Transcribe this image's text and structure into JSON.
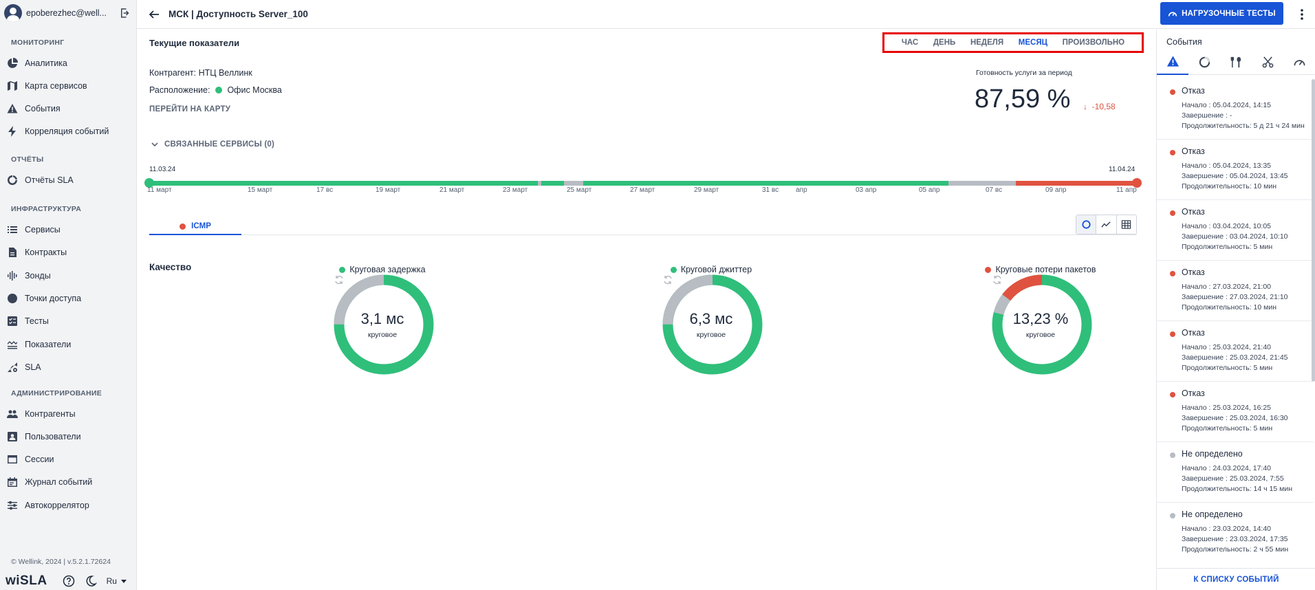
{
  "user": {
    "name": "epoberezhec@well..."
  },
  "sidebar": {
    "sections": [
      {
        "title": "МОНИТОРИНГ",
        "items": [
          {
            "label": "Аналитика",
            "icon": "pie-chart-icon"
          },
          {
            "label": "Карта сервисов",
            "icon": "map-icon"
          },
          {
            "label": "События",
            "icon": "warning-icon"
          },
          {
            "label": "Корреляция событий",
            "icon": "lightning-icon"
          }
        ]
      },
      {
        "title": "ОТЧЁТЫ",
        "items": [
          {
            "label": "Отчёты SLA",
            "icon": "donut-icon"
          }
        ]
      },
      {
        "title": "ИНФРАСТРУКТУРА",
        "items": [
          {
            "label": "Сервисы",
            "icon": "list-icon"
          },
          {
            "label": "Контракты",
            "icon": "document-icon"
          },
          {
            "label": "Зонды",
            "icon": "waveform-icon"
          },
          {
            "label": "Точки доступа",
            "icon": "circle-icon"
          },
          {
            "label": "Тесты",
            "icon": "checklist-icon"
          },
          {
            "label": "Показатели",
            "icon": "layers-icon"
          },
          {
            "label": "SLA",
            "icon": "signal-gear-icon"
          }
        ]
      },
      {
        "title": "АДМИНИСТРИРОВАНИЕ",
        "items": [
          {
            "label": "Контрагенты",
            "icon": "people-icon"
          },
          {
            "label": "Пользователи",
            "icon": "user-card-icon"
          },
          {
            "label": "Сессии",
            "icon": "browser-icon"
          },
          {
            "label": "Журнал событий",
            "icon": "calendar-icon"
          },
          {
            "label": "Автокоррелятор",
            "icon": "sliders-icon"
          }
        ]
      }
    ],
    "copyright": "© Wellink, 2024 | v.5.2.1.72624",
    "logo": "wiSLA",
    "language": "Ru"
  },
  "header": {
    "title": "МСК | Доступность Server_100",
    "load_tests_button": "НАГРУЗОЧНЫЕ ТЕСТЫ"
  },
  "main": {
    "section_title": "Текущие показатели",
    "periods": [
      {
        "label": "ЧАС",
        "active": false
      },
      {
        "label": "ДЕНЬ",
        "active": false
      },
      {
        "label": "НЕДЕЛЯ",
        "active": false
      },
      {
        "label": "МЕСЯЦ",
        "active": true
      },
      {
        "label": "ПРОИЗВОЛЬНО",
        "active": false
      }
    ],
    "contractor": "Контрагент: НТЦ Веллинк",
    "location_label": "Расположение:",
    "location_value": "Офис Москва",
    "map_link": "ПЕРЕЙТИ НА КАРТУ",
    "availability_label": "Готовность услуги за период",
    "availability_value": "87,59 %",
    "availability_delta": "-10,58",
    "related_services": "СВЯЗАННЫЕ СЕРВИСЫ (0)",
    "timeline": {
      "start_date": "11.03.24",
      "end_date": "11.04.24",
      "labels": [
        "11 март",
        "15 март",
        "17 вс",
        "19 март",
        "21 март",
        "23 март",
        "25 март",
        "27 март",
        "29 март",
        "31 вс",
        "апр",
        "03 апр",
        "05 апр",
        "07 вс",
        "09 апр",
        "11 апр"
      ],
      "colors": {
        "ok": "#2fbf7a",
        "unknown": "#b8bcc3",
        "fail": "#e05240"
      }
    },
    "protocol_tab": "ICMP",
    "quality_title": "Качество",
    "gauges": [
      {
        "label": "Круговая задержка",
        "status_color": "#2fbf7a",
        "value": "3,1 мс",
        "sub": "круговое"
      },
      {
        "label": "Круговой джиттер",
        "status_color": "#2fbf7a",
        "value": "6,3 мс",
        "sub": "круговое"
      },
      {
        "label": "Круговые потери пакетов",
        "status_color": "#e05240",
        "value": "13,23 %",
        "sub": "круговое"
      }
    ]
  },
  "events": {
    "title": "События",
    "tabs": [
      "warning-icon",
      "donut-icon",
      "tools-icon",
      "scissors-icon",
      "speedometer-icon"
    ],
    "items": [
      {
        "status": "Отказ",
        "color": "#e05240",
        "start": "Начало : 05.04.2024, 14:15",
        "end": "Завершение : -",
        "duration": "Продолжительность: 5 д 21 ч 24 мин"
      },
      {
        "status": "Отказ",
        "color": "#e05240",
        "start": "Начало : 05.04.2024, 13:35",
        "end": "Завершение : 05.04.2024, 13:45",
        "duration": "Продолжительность: 10 мин"
      },
      {
        "status": "Отказ",
        "color": "#e05240",
        "start": "Начало : 03.04.2024, 10:05",
        "end": "Завершение : 03.04.2024, 10:10",
        "duration": "Продолжительность: 5 мин"
      },
      {
        "status": "Отказ",
        "color": "#e05240",
        "start": "Начало : 27.03.2024, 21:00",
        "end": "Завершение : 27.03.2024, 21:10",
        "duration": "Продолжительность: 10 мин"
      },
      {
        "status": "Отказ",
        "color": "#e05240",
        "start": "Начало : 25.03.2024, 21:40",
        "end": "Завершение : 25.03.2024, 21:45",
        "duration": "Продолжительность: 5 мин"
      },
      {
        "status": "Отказ",
        "color": "#e05240",
        "start": "Начало : 25.03.2024, 16:25",
        "end": "Завершение : 25.03.2024, 16:30",
        "duration": "Продолжительность: 5 мин"
      },
      {
        "status": "Не определено",
        "color": "#b8bcc3",
        "start": "Начало : 24.03.2024, 17:40",
        "end": "Завершение : 25.03.2024, 7:55",
        "duration": "Продолжительность: 14 ч 15 мин"
      },
      {
        "status": "Не определено",
        "color": "#b8bcc3",
        "start": "Начало : 23.03.2024, 14:40",
        "end": "Завершение : 23.03.2024, 17:35",
        "duration": "Продолжительность: 2 ч 55 мин"
      }
    ],
    "footer": "К СПИСКУ СОБЫТИЙ"
  }
}
